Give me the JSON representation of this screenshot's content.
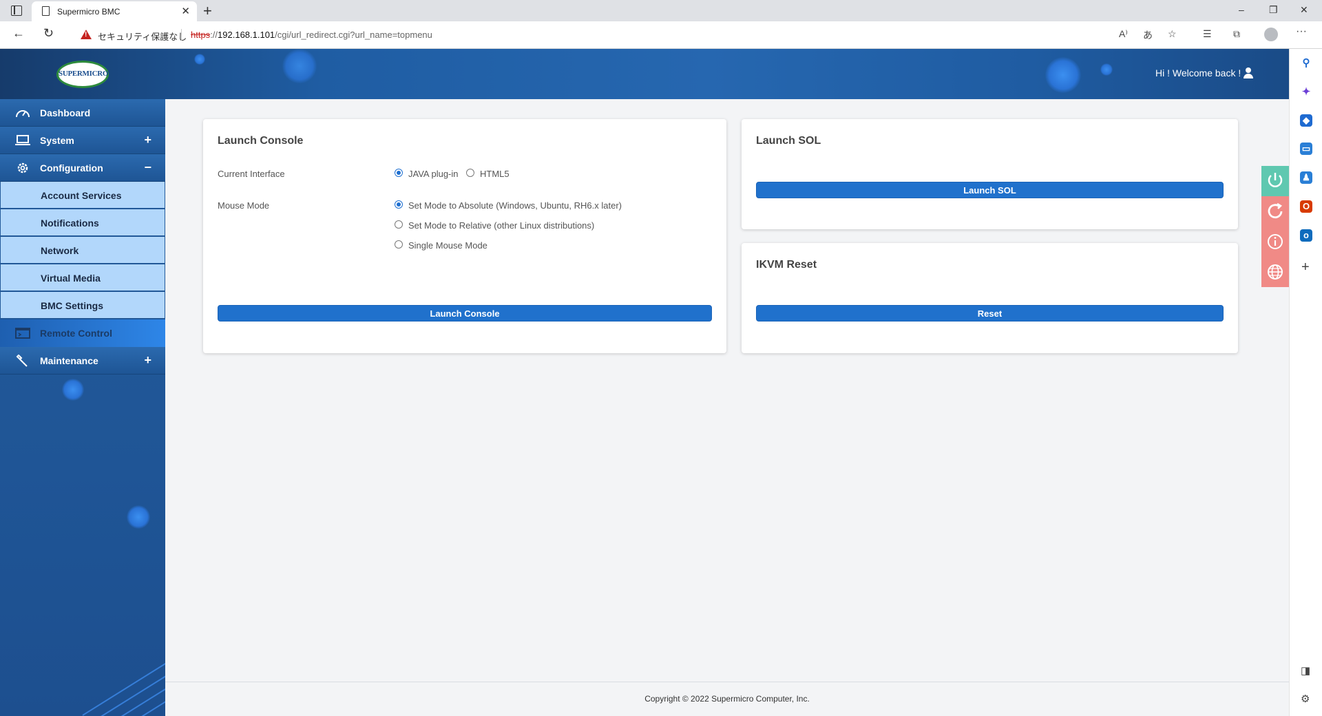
{
  "browser": {
    "tab_title": "Supermicro BMC",
    "tab_close": "✕",
    "new_tab": "+",
    "security_warning": "セキュリティ保護なし",
    "url_scheme": "https",
    "url_sep": "://",
    "url_host": "192.168.1.101",
    "url_path": "/cgi/url_redirect.cgi?url_name=topmenu",
    "window_controls": [
      "–",
      "❐",
      "✕"
    ],
    "more": "···"
  },
  "header": {
    "logo_text": "SUPERMICRO",
    "welcome": "Hi ! Welcome back !"
  },
  "sidebar": {
    "items": [
      {
        "label": "Dashboard",
        "icon": "dashboard-icon",
        "toggle": ""
      },
      {
        "label": "System",
        "icon": "laptop-icon",
        "toggle": "+"
      },
      {
        "label": "Configuration",
        "icon": "gear-icon",
        "toggle": "−"
      }
    ],
    "subitems": [
      "Account Services",
      "Notifications",
      "Network",
      "Virtual Media",
      "BMC Settings"
    ],
    "remote_control": "Remote Control",
    "maintenance": {
      "label": "Maintenance",
      "toggle": "+"
    }
  },
  "console_card": {
    "title": "Launch Console",
    "interface_label": "Current Interface",
    "interface_options": [
      "JAVA plug-in",
      "HTML5"
    ],
    "interface_selected": "JAVA plug-in",
    "mouse_label": "Mouse Mode",
    "mouse_options": [
      "Set Mode to Absolute (Windows, Ubuntu, RH6.x later)",
      "Set Mode to Relative (other Linux distributions)",
      "Single Mouse Mode"
    ],
    "mouse_selected": "Set Mode to Absolute (Windows, Ubuntu, RH6.x later)",
    "button": "Launch Console"
  },
  "sol_card": {
    "title": "Launch SOL",
    "button": "Launch SOL"
  },
  "ikvm_card": {
    "title": "IKVM Reset",
    "button": "Reset"
  },
  "footer": {
    "copyright": "Copyright © 2022 Supermicro Computer, Inc."
  },
  "colors": {
    "primary_button": "#2071cc",
    "header_blue": "#2667b0",
    "submenu_bg": "#b2d7fb",
    "power_green": "#5fc8b0",
    "power_red": "#f08a86"
  }
}
